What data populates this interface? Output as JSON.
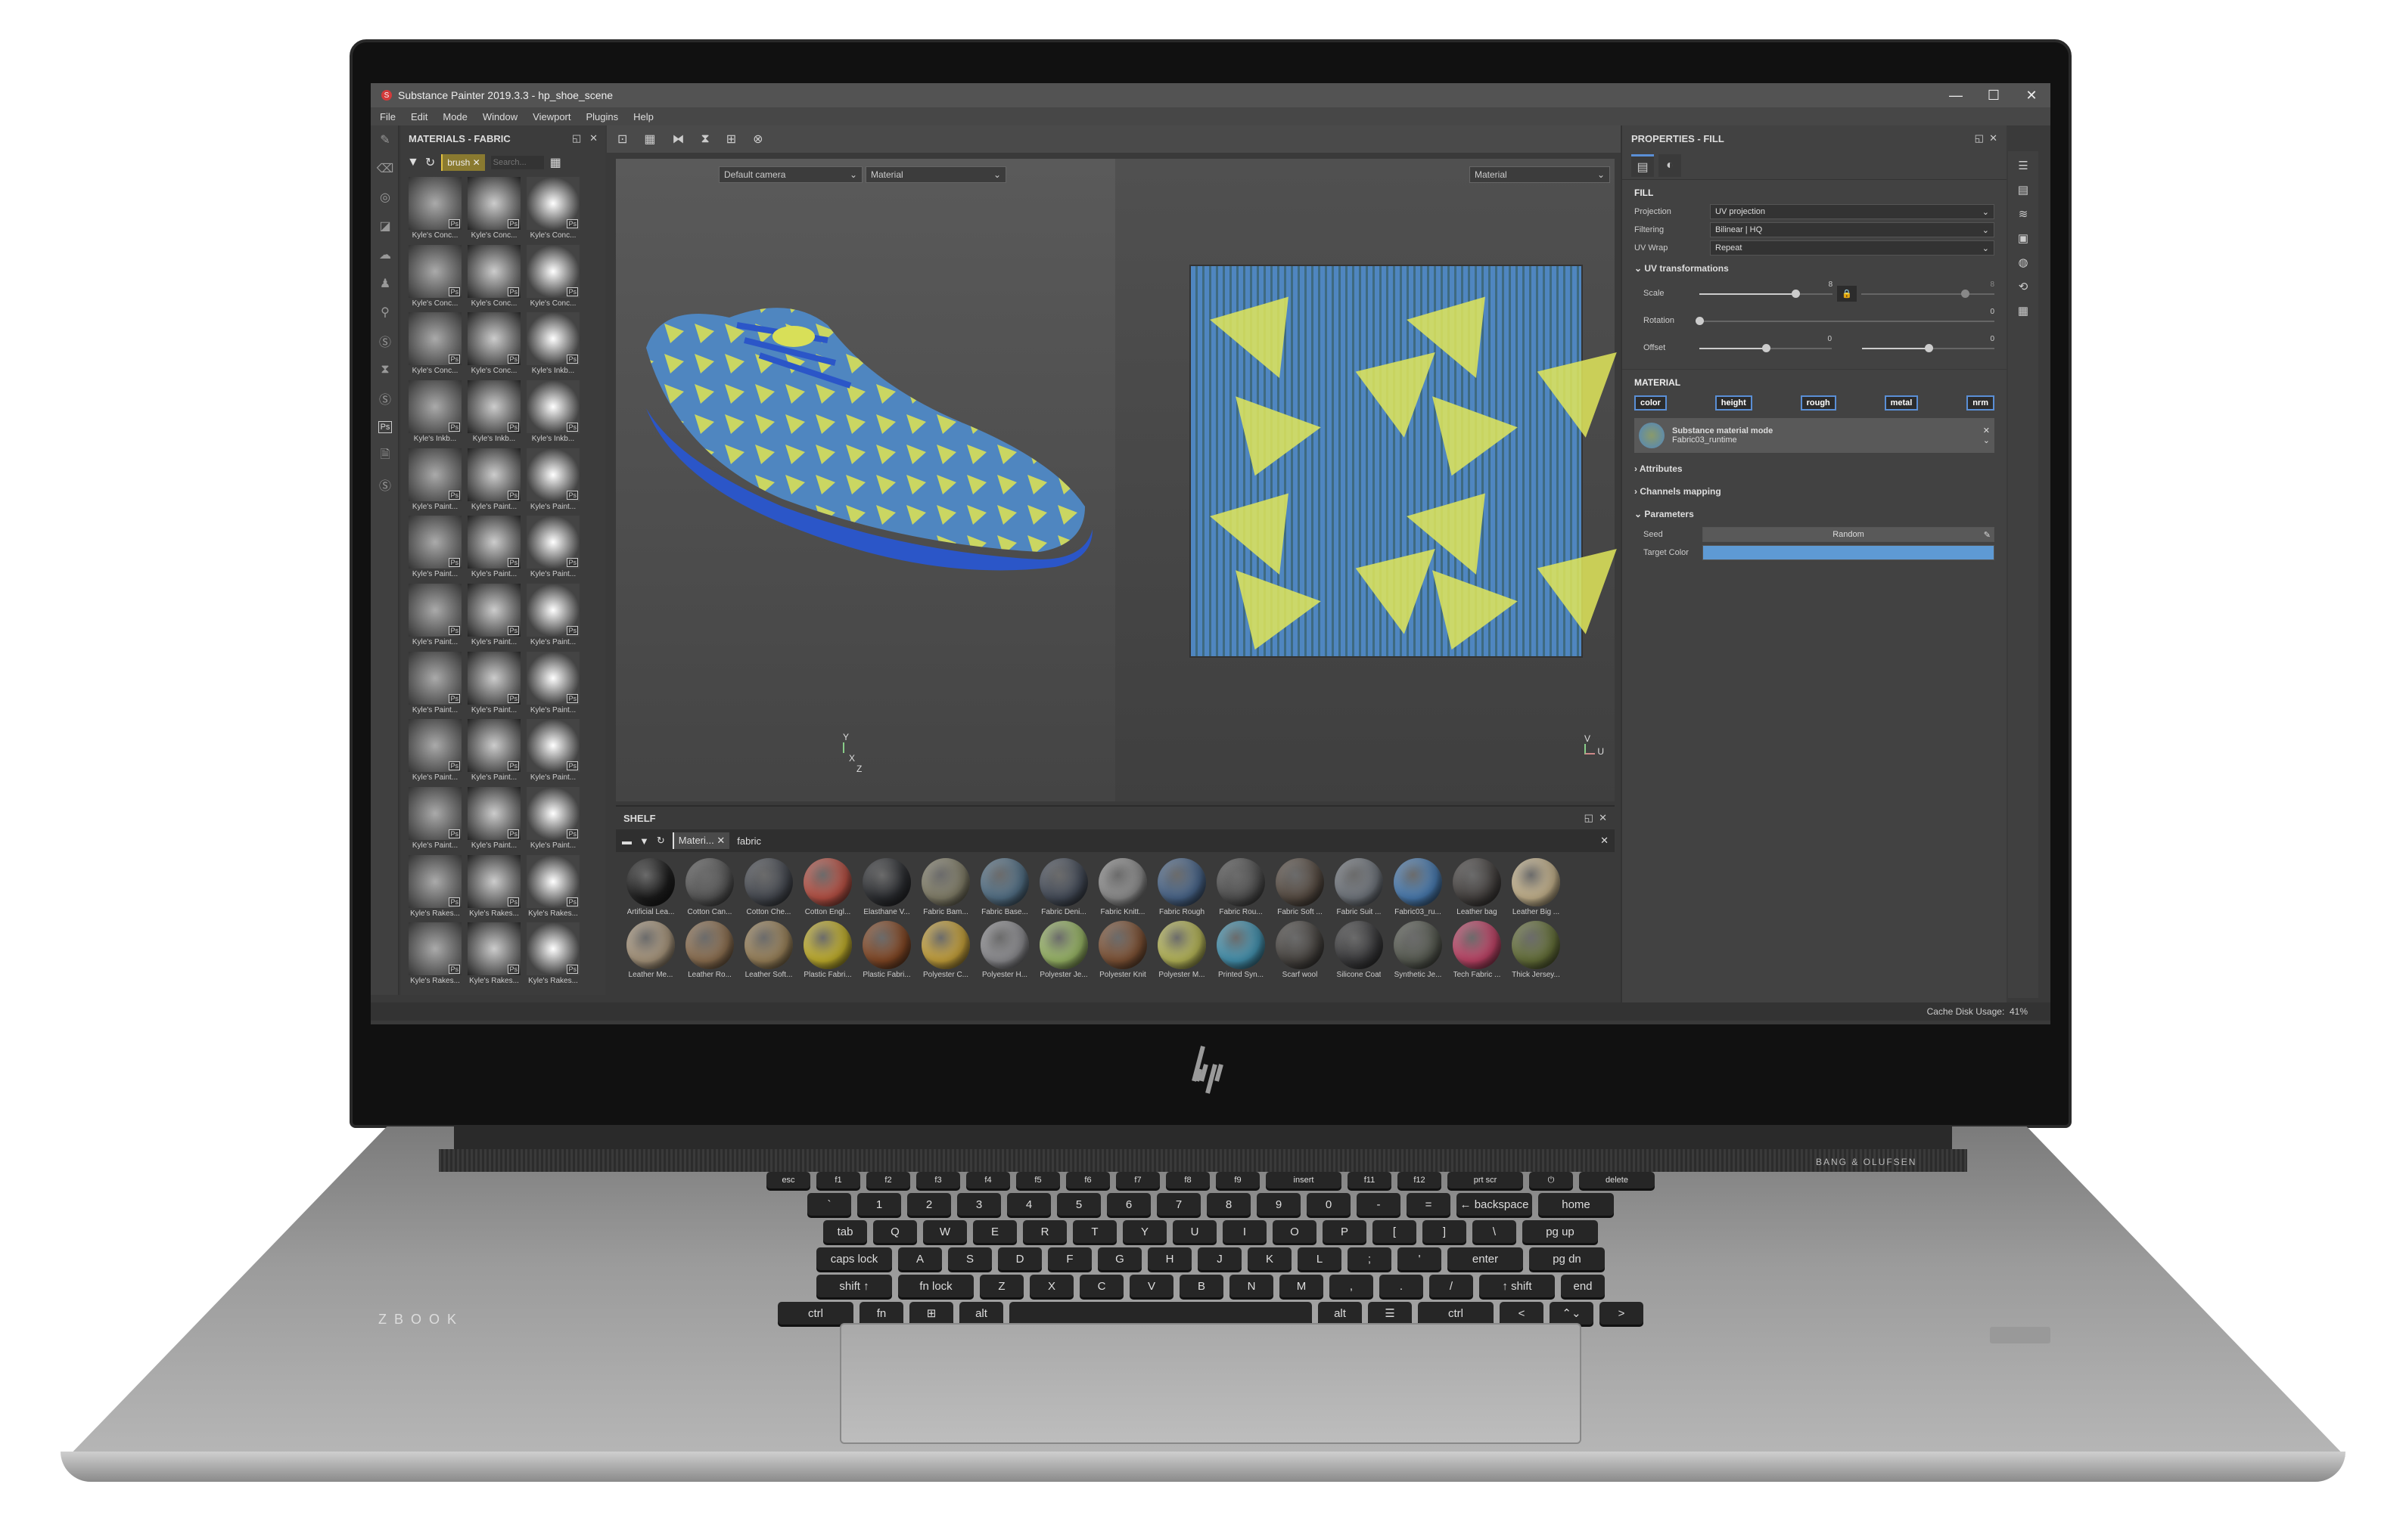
{
  "app": {
    "title": "Substance Painter 2019.3.3 - hp_shoe_scene",
    "menu": [
      "File",
      "Edit",
      "Mode",
      "Window",
      "Viewport",
      "Plugins",
      "Help"
    ],
    "window_controls": {
      "minimize": "—",
      "maximize": "☐",
      "close": "✕"
    }
  },
  "materials_panel": {
    "title": "MATERIALS - FABRIC",
    "filter_chip": "brush",
    "search_placeholder": "Search...",
    "items": [
      "Kyle's Conc...",
      "Kyle's Conc...",
      "Kyle's Conc...",
      "Kyle's Conc...",
      "Kyle's Conc...",
      "Kyle's Conc...",
      "Kyle's Conc...",
      "Kyle's Conc...",
      "Kyle's Inkb...",
      "Kyle's Inkb...",
      "Kyle's Inkb...",
      "Kyle's Inkb...",
      "Kyle's Paint...",
      "Kyle's Paint...",
      "Kyle's Paint...",
      "Kyle's Paint...",
      "Kyle's Paint...",
      "Kyle's Paint...",
      "Kyle's Paint...",
      "Kyle's Paint...",
      "Kyle's Paint...",
      "Kyle's Paint...",
      "Kyle's Paint...",
      "Kyle's Paint...",
      "Kyle's Paint...",
      "Kyle's Paint...",
      "Kyle's Paint...",
      "Kyle's Paint...",
      "Kyle's Paint...",
      "Kyle's Paint...",
      "Kyle's Rakes...",
      "Kyle's Rakes...",
      "Kyle's Rakes...",
      "Kyle's Rakes...",
      "Kyle's Rakes...",
      "Kyle's Rakes..."
    ],
    "badge": "Ps"
  },
  "viewport": {
    "camera": "Default camera",
    "mode_3d": "Material",
    "mode_2d": "Material",
    "gizmo_3d": {
      "y": "Y",
      "x": "X",
      "z": "Z"
    },
    "gizmo_2d": {
      "v": "V",
      "u": "U"
    }
  },
  "shelf": {
    "title": "SHELF",
    "filter_chip": "Materi...",
    "search_value": "fabric",
    "items": [
      {
        "label": "Artificial Lea...",
        "color": "#1e1e1e"
      },
      {
        "label": "Cotton Can...",
        "color": "#5e5e5e"
      },
      {
        "label": "Cotton Che...",
        "color": "#4c5058"
      },
      {
        "label": "Cotton Engl...",
        "color": "#c8584a"
      },
      {
        "label": "Elasthane V...",
        "color": "#2e3034"
      },
      {
        "label": "Fabric Bam...",
        "color": "#8e8a72"
      },
      {
        "label": "Fabric Base...",
        "color": "#5a7a92"
      },
      {
        "label": "Fabric Deni...",
        "color": "#4a5260"
      },
      {
        "label": "Fabric Knitt...",
        "color": "#9a9a9a"
      },
      {
        "label": "Fabric Rough",
        "color": "#4f6e96"
      },
      {
        "label": "Fabric Rou...",
        "color": "#575757"
      },
      {
        "label": "Fabric Soft ...",
        "color": "#5e5248"
      },
      {
        "label": "Fabric Suit ...",
        "color": "#7a8088"
      },
      {
        "label": "Fabric03_ru...",
        "color": "#4f86c0"
      },
      {
        "label": "Leather bag",
        "color": "#4a4644"
      },
      {
        "label": "Leather Big ...",
        "color": "#d8c49a"
      },
      {
        "label": "Leather Me...",
        "color": "#b8a488"
      },
      {
        "label": "Leather Ro...",
        "color": "#9a7a58"
      },
      {
        "label": "Leather Soft...",
        "color": "#a88e62"
      },
      {
        "label": "Plastic Fabri...",
        "color": "#d4c030"
      },
      {
        "label": "Plastic Fabri...",
        "color": "#8e4e28"
      },
      {
        "label": "Polyester C...",
        "color": "#d8b040"
      },
      {
        "label": "Polyester H...",
        "color": "#9a9a9e"
      },
      {
        "label": "Polyester Je...",
        "color": "#a8c870"
      },
      {
        "label": "Polyester Knit",
        "color": "#8a5a3a"
      },
      {
        "label": "Polyester M...",
        "color": "#c8c860"
      },
      {
        "label": "Printed Syn...",
        "color": "#4aa0c0"
      },
      {
        "label": "Scarf wool",
        "color": "#4e4a46"
      },
      {
        "label": "Silicone Coat",
        "color": "#3e3e40"
      },
      {
        "label": "Synthetic Je...",
        "color": "#5e6258"
      },
      {
        "label": "Tech Fabric ...",
        "color": "#d04a70"
      },
      {
        "label": "Thick Jersey...",
        "color": "#6e7a3e"
      }
    ]
  },
  "properties": {
    "title": "PROPERTIES - FILL",
    "fill_section": "FILL",
    "projection": {
      "label": "Projection",
      "value": "UV projection"
    },
    "filtering": {
      "label": "Filtering",
      "value": "Bilinear | HQ"
    },
    "uv_wrap": {
      "label": "UV Wrap",
      "value": "Repeat"
    },
    "uv_transformations": "UV transformations",
    "scale": {
      "label": "Scale",
      "value_u": "8",
      "value_v": "8",
      "fraction_u": 0.72,
      "fraction_v": 0.78
    },
    "rotation": {
      "label": "Rotation",
      "value": "0",
      "fraction": 0.0
    },
    "offset": {
      "label": "Offset",
      "value_u": "0",
      "value_v": "0",
      "fraction_u": 0.5,
      "fraction_v": 0.5
    },
    "material_section": "MATERIAL",
    "channels": [
      "color",
      "height",
      "rough",
      "metal",
      "nrm"
    ],
    "substance_mode": "Substance material mode",
    "substance_name": "Fabric03_runtime",
    "attributes": "Attributes",
    "channels_mapping": "Channels mapping",
    "parameters": "Parameters",
    "seed": {
      "label": "Seed",
      "value": "Random"
    },
    "target_color": {
      "label": "Target Color",
      "color": "#5e9ad4"
    }
  },
  "status": {
    "cache_label": "Cache Disk Usage:",
    "cache_value": "41%"
  },
  "laptop": {
    "brand_speaker": "BANG & OLUFSEN",
    "model": "ZBOOK",
    "logo": "hp"
  },
  "keyboard": {
    "rows": [
      [
        "esc",
        "f1",
        "f2",
        "f3",
        "f4",
        "f5",
        "f6",
        "f7",
        "f8",
        "f9",
        "insert",
        "f11",
        "f12",
        "prt scr",
        "⏻",
        "delete"
      ],
      [
        "`",
        "1",
        "2",
        "3",
        "4",
        "5",
        "6",
        "7",
        "8",
        "9",
        "0",
        "-",
        "=",
        "← backspace",
        "home"
      ],
      [
        "tab",
        "Q",
        "W",
        "E",
        "R",
        "T",
        "Y",
        "U",
        "I",
        "O",
        "P",
        "[",
        "]",
        "\\",
        "pg up"
      ],
      [
        "caps lock",
        "A",
        "S",
        "D",
        "F",
        "G",
        "H",
        "J",
        "K",
        "L",
        ";",
        "'",
        "enter",
        "pg dn"
      ],
      [
        "shift ↑",
        "fn lock",
        "Z",
        "X",
        "C",
        "V",
        "B",
        "N",
        "M",
        ",",
        ".",
        "/",
        "↑ shift",
        "end"
      ],
      [
        "ctrl",
        "fn",
        "⊞",
        "alt",
        "",
        "alt",
        "☰",
        "ctrl",
        "<",
        "⌃⌄",
        ">"
      ]
    ]
  }
}
